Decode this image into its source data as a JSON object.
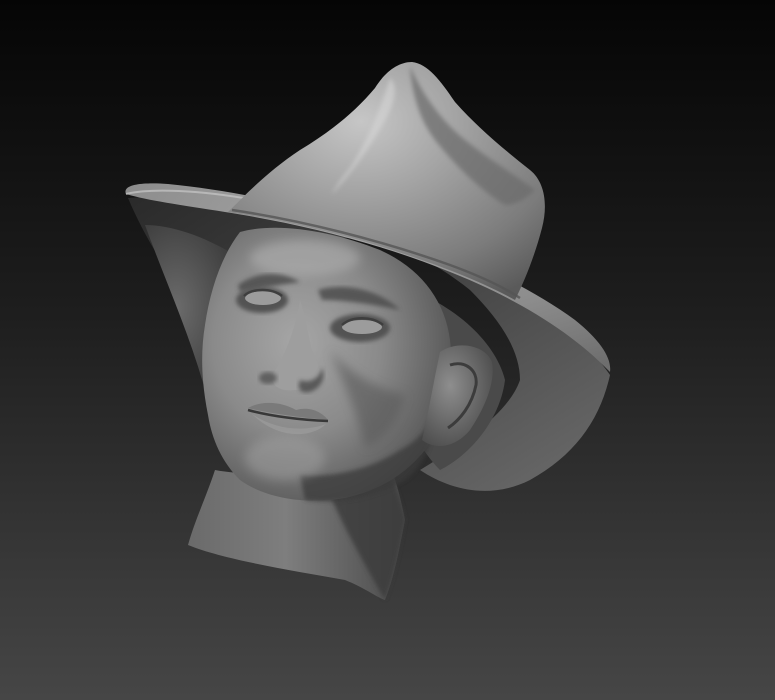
{
  "scene": {
    "subject": "sculpted-head-with-hat",
    "colors": {
      "background_top": "#050505",
      "background_bottom": "#464646",
      "clay_light": "#b4b4b4",
      "clay_mid": "#8a8a8a",
      "clay_dark": "#3c3c3c",
      "shadow": "#151515"
    }
  }
}
